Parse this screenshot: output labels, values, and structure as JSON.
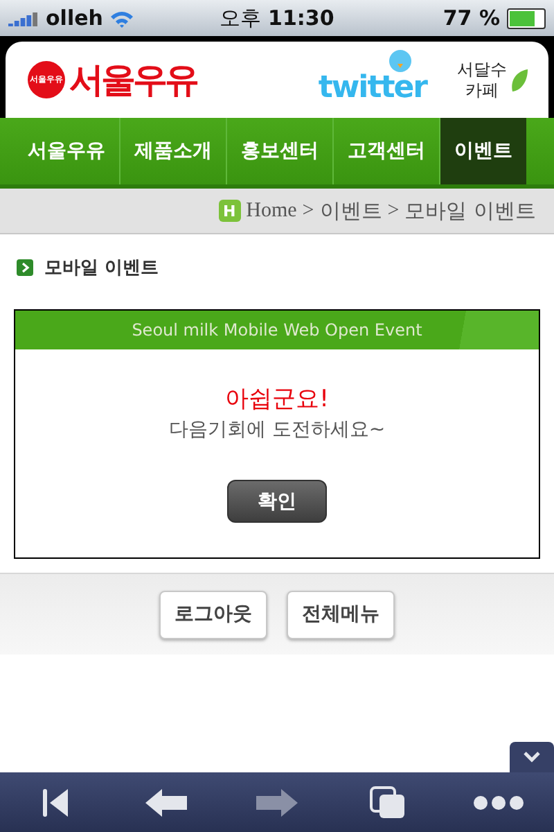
{
  "status_bar": {
    "carrier": "olleh",
    "time_prefix": "오후",
    "time": "11:30",
    "battery": "77 %"
  },
  "header": {
    "brand": "서울우유",
    "brand_badge": "서울우유",
    "twitter": "twitter",
    "cafe_line1": "서달수",
    "cafe_line2": "카페"
  },
  "nav": [
    {
      "label": "서울우유",
      "selected": false
    },
    {
      "label": "제품소개",
      "selected": false
    },
    {
      "label": "홍보센터",
      "selected": false
    },
    {
      "label": "고객센터",
      "selected": false
    },
    {
      "label": "이벤트",
      "selected": true
    }
  ],
  "breadcrumb": {
    "icon_letter": "H",
    "home": "Home",
    "sep1": ">",
    "level1": "이벤트",
    "sep2": ">",
    "level2": "모바일 이벤트"
  },
  "section_title": "모바일 이벤트",
  "event": {
    "banner": "Seoul milk Mobile Web Open Event",
    "headline": "아쉽군요!",
    "message": "다음기회에 도전하세요~",
    "confirm": "확인"
  },
  "footer_buttons": [
    "로그아웃",
    "전체메뉴"
  ],
  "toolbar": [
    {
      "kind": "first",
      "disabled": false
    },
    {
      "kind": "back",
      "disabled": false
    },
    {
      "kind": "forward",
      "disabled": true
    },
    {
      "kind": "pages",
      "disabled": false
    },
    {
      "kind": "more",
      "disabled": false
    }
  ]
}
